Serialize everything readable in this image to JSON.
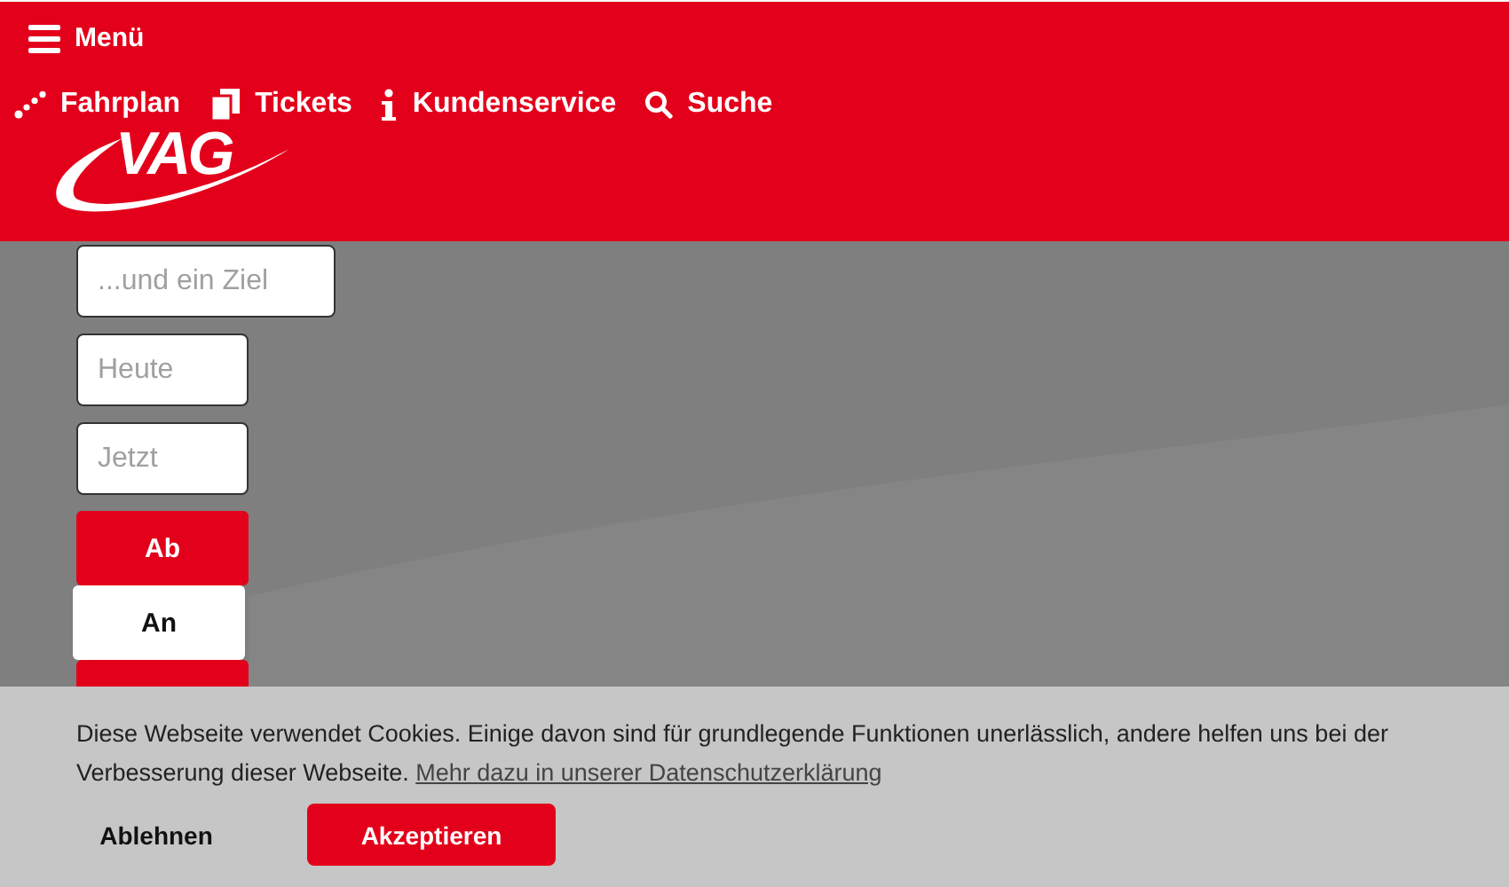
{
  "header": {
    "menu_label": "Menü",
    "nav": [
      {
        "label": "Fahrplan"
      },
      {
        "label": "Tickets"
      },
      {
        "label": "Kundenservice"
      },
      {
        "label": "Suche"
      }
    ],
    "logo": "VAG"
  },
  "form": {
    "fields": [
      {
        "placeholder": "...und ein Ziel"
      },
      {
        "placeholder": "Heute"
      },
      {
        "placeholder": "Jetzt"
      }
    ],
    "mode_options": [
      {
        "label": "Ab",
        "selected": true
      },
      {
        "label": "An",
        "selected": false
      },
      {
        "selected": true
      }
    ]
  },
  "cookie_banner": {
    "text": "Diese Webseite verwendet Cookies. Einige davon sind für grundlegende Funktionen unerlässlich, andere helfen uns bei der Verbesserung dieser Webseite.",
    "link": "Mehr dazu in unserer Datenschutzerklärung",
    "buttons": [
      {
        "label": "Ablehnen",
        "kind": "plain"
      },
      {
        "label": "Akzeptieren",
        "kind": "primary"
      }
    ]
  }
}
